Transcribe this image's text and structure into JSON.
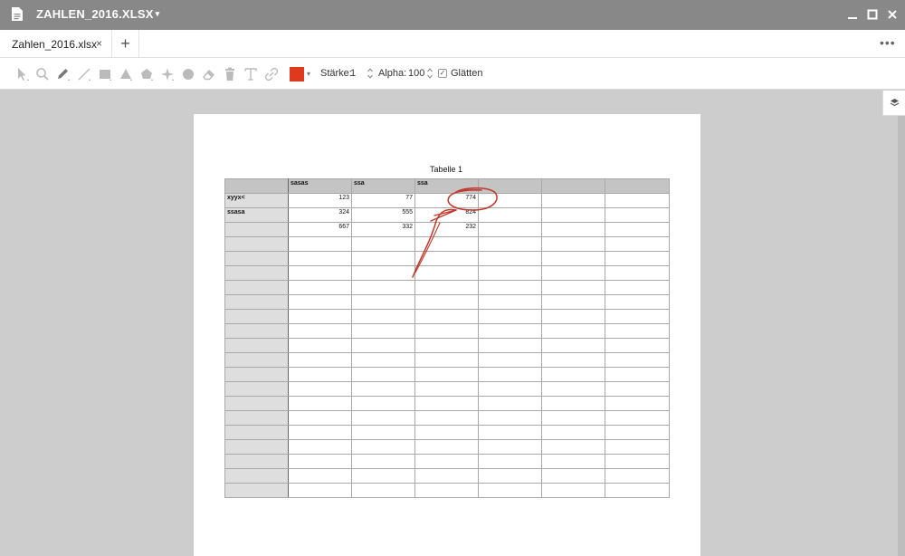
{
  "window": {
    "title": "ZAHLEN_2016.XLSX",
    "title_caret": "▾"
  },
  "tabs": [
    {
      "label": "Zahlen_2016.xlsx",
      "close": "×"
    }
  ],
  "tab_add": "+",
  "tab_more": "•••",
  "toolbar": {
    "stroke_label": "Stärke:",
    "stroke_value": "1",
    "alpha_label": "Alpha:",
    "alpha_value": "100",
    "smooth_label": "Glätten",
    "smooth_checked": "✓",
    "color": "#e03a1e",
    "color_caret": "▾"
  },
  "sheet": {
    "title": "Tabelle 1",
    "headers": [
      "",
      "sasas",
      "ssa",
      "ssa",
      "",
      "",
      ""
    ],
    "rows": [
      [
        "xyyx<",
        "123",
        "77",
        "774",
        "",
        "",
        ""
      ],
      [
        "ssasa",
        "324",
        "555",
        "824",
        "",
        "",
        ""
      ],
      [
        "",
        "667",
        "332",
        "232",
        "",
        "",
        ""
      ],
      [
        "",
        "",
        "",
        "",
        "",
        "",
        ""
      ],
      [
        "",
        "",
        "",
        "",
        "",
        "",
        ""
      ],
      [
        "",
        "",
        "",
        "",
        "",
        "",
        ""
      ],
      [
        "",
        "",
        "",
        "",
        "",
        "",
        ""
      ],
      [
        "",
        "",
        "",
        "",
        "",
        "",
        ""
      ],
      [
        "",
        "",
        "",
        "",
        "",
        "",
        ""
      ],
      [
        "",
        "",
        "",
        "",
        "",
        "",
        ""
      ],
      [
        "",
        "",
        "",
        "",
        "",
        "",
        ""
      ],
      [
        "",
        "",
        "",
        "",
        "",
        "",
        ""
      ],
      [
        "",
        "",
        "",
        "",
        "",
        "",
        ""
      ],
      [
        "",
        "",
        "",
        "",
        "",
        "",
        ""
      ],
      [
        "",
        "",
        "",
        "",
        "",
        "",
        ""
      ],
      [
        "",
        "",
        "",
        "",
        "",
        "",
        ""
      ],
      [
        "",
        "",
        "",
        "",
        "",
        "",
        ""
      ],
      [
        "",
        "",
        "",
        "",
        "",
        "",
        ""
      ],
      [
        "",
        "",
        "",
        "",
        "",
        "",
        ""
      ],
      [
        "",
        "",
        "",
        "",
        "",
        "",
        ""
      ],
      [
        "",
        "",
        "",
        "",
        "",
        "",
        ""
      ]
    ]
  },
  "annotation_color": "#c0392b"
}
